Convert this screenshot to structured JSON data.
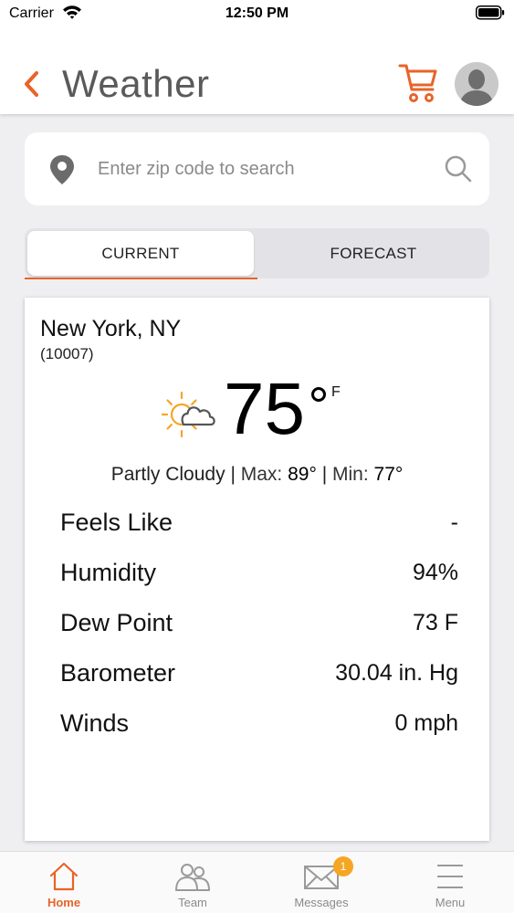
{
  "status_bar": {
    "carrier": "Carrier",
    "time": "12:50 PM"
  },
  "header": {
    "title": "Weather",
    "icons": [
      "back-chevron-icon",
      "cart-icon",
      "avatar"
    ]
  },
  "search": {
    "placeholder": "Enter zip code to search",
    "value": ""
  },
  "tabs": [
    {
      "label": "CURRENT",
      "selected": true
    },
    {
      "label": "FORECAST",
      "selected": false
    }
  ],
  "weather": {
    "city": "New York, NY",
    "zip": "(10007)",
    "icon": "partly-cloudy-icon",
    "temperature": "75",
    "unit": "F",
    "condition": "Partly Cloudy",
    "max_label": "Max:",
    "max": "89°",
    "min_label": "Min:",
    "min": "77°",
    "details": [
      {
        "label": "Feels Like",
        "value": "-"
      },
      {
        "label": "Humidity",
        "value": "94%"
      },
      {
        "label": "Dew Point",
        "value": "73 F"
      },
      {
        "label": "Barometer",
        "value": "30.04 in. Hg"
      },
      {
        "label": "Winds",
        "value": "0 mph"
      }
    ]
  },
  "tabbar": {
    "items": [
      {
        "label": "Home",
        "icon": "home-icon",
        "active": true
      },
      {
        "label": "Team",
        "icon": "team-icon",
        "active": false
      },
      {
        "label": "Messages",
        "icon": "mail-icon",
        "active": false,
        "badge": "1"
      },
      {
        "label": "Menu",
        "icon": "menu-icon",
        "active": false
      }
    ]
  },
  "colors": {
    "accent": "#e8632a",
    "badge": "#f5a623",
    "background": "#efeff2"
  }
}
